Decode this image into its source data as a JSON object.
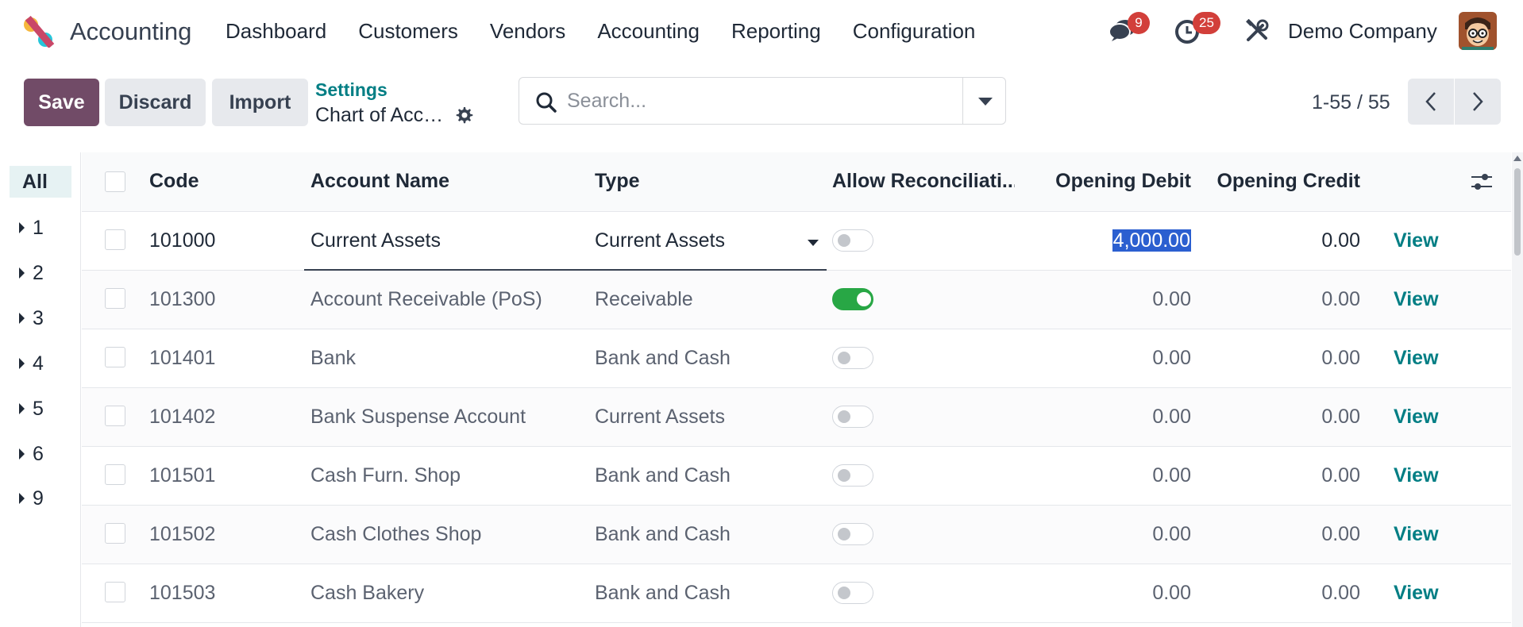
{
  "navbar": {
    "app_name": "Accounting",
    "menu": [
      "Dashboard",
      "Customers",
      "Vendors",
      "Accounting",
      "Reporting",
      "Configuration"
    ],
    "messages_badge": "9",
    "activities_badge": "25",
    "company": "Demo Company"
  },
  "controls": {
    "save_label": "Save",
    "discard_label": "Discard",
    "import_label": "Import",
    "breadcrumb_parent": "Settings",
    "breadcrumb_current": "Chart of Accounts",
    "search_placeholder": "Search...",
    "pager": "1-55 / 55"
  },
  "sidebar": {
    "items": [
      "All",
      "1",
      "2",
      "3",
      "4",
      "5",
      "6",
      "9"
    ]
  },
  "table": {
    "columns": {
      "code": "Code",
      "name": "Account Name",
      "type": "Type",
      "reconcile": "Allow Reconciliati...",
      "debit": "Opening Debit",
      "credit": "Opening Credit"
    },
    "view_label": "View",
    "rows": [
      {
        "code": "101000",
        "name": "Current Assets",
        "type": "Current Assets",
        "reconcile": false,
        "debit": "4,000.00",
        "credit": "0.00"
      },
      {
        "code": "101300",
        "name": "Account Receivable (PoS)",
        "type": "Receivable",
        "reconcile": true,
        "debit": "0.00",
        "credit": "0.00"
      },
      {
        "code": "101401",
        "name": "Bank",
        "type": "Bank and Cash",
        "reconcile": false,
        "debit": "0.00",
        "credit": "0.00"
      },
      {
        "code": "101402",
        "name": "Bank Suspense Account",
        "type": "Current Assets",
        "reconcile": false,
        "debit": "0.00",
        "credit": "0.00"
      },
      {
        "code": "101501",
        "name": "Cash Furn. Shop",
        "type": "Bank and Cash",
        "reconcile": false,
        "debit": "0.00",
        "credit": "0.00"
      },
      {
        "code": "101502",
        "name": "Cash Clothes Shop",
        "type": "Bank and Cash",
        "reconcile": false,
        "debit": "0.00",
        "credit": "0.00"
      },
      {
        "code": "101503",
        "name": "Cash Bakery",
        "type": "Bank and Cash",
        "reconcile": false,
        "debit": "0.00",
        "credit": "0.00"
      }
    ]
  },
  "colors": {
    "primary": "#714b67",
    "link": "#017e84",
    "toggle_on": "#28a745",
    "badge": "#d23f3a",
    "selection": "#2b5fd0"
  },
  "icons": [
    "app-logo",
    "chat-icon",
    "clock-icon",
    "tools-icon",
    "gear-icon",
    "search-icon",
    "caret-down-icon",
    "chevron-left-icon",
    "chevron-right-icon",
    "caret-right-icon",
    "column-settings-icon"
  ]
}
